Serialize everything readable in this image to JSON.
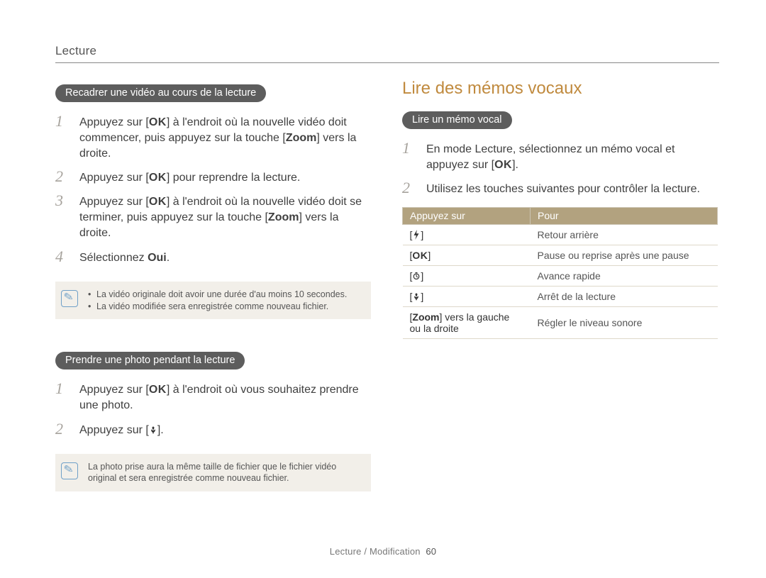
{
  "header": {
    "section": "Lecture"
  },
  "footer": {
    "breadcrumb": "Lecture / Modification",
    "page_number": "60"
  },
  "left": {
    "pill1": "Recadrer une vidéo au cours de la lecture",
    "steps1": {
      "s1a": "Appuyez sur [",
      "s1b": "] à l'endroit où la nouvelle vidéo doit commencer, puis appuyez sur la touche [",
      "s1c": "] vers la droite.",
      "s1_zoom": "Zoom",
      "s2a": "Appuyez sur [",
      "s2b": "] pour reprendre la lecture.",
      "s3a": "Appuyez sur [",
      "s3b": "] à l'endroit où la nouvelle vidéo doit se terminer, puis appuyez sur la touche [",
      "s3c": "] vers la droite.",
      "s3_zoom": "Zoom",
      "s4a": "Sélectionnez ",
      "s4b": "Oui",
      "s4c": "."
    },
    "note1": {
      "b1": "La vidéo originale doit avoir une durée d'au moins 10 secondes.",
      "b2": "La vidéo modifiée sera enregistrée comme nouveau fichier."
    },
    "pill2": "Prendre une photo pendant la lecture",
    "steps2": {
      "s1a": "Appuyez sur [",
      "s1b": "] à l'endroit où vous souhaitez prendre une photo.",
      "s2a": "Appuyez sur [",
      "s2b": "]."
    },
    "note2": "La photo prise aura la même taille de fichier que le fichier vidéo original et sera enregistrée comme nouveau fichier."
  },
  "right": {
    "title": "Lire des mémos vocaux",
    "pill": "Lire un mémo vocal",
    "steps": {
      "s1a": "En mode Lecture, sélectionnez un mémo vocal et appuyez sur [",
      "s1b": "].",
      "s2": "Utilisez les touches suivantes pour contrôler la lecture."
    },
    "table": {
      "head": {
        "c1": "Appuyez sur",
        "c2": "Pour"
      },
      "rows": [
        {
          "key_open": "[",
          "icon": "bolt-icon",
          "key_close": "]",
          "desc": "Retour arrière"
        },
        {
          "key_open": "[",
          "icon": "ok",
          "key_close": "]",
          "desc": "Pause ou reprise après une pause"
        },
        {
          "key_open": "[",
          "icon": "timer-icon",
          "key_close": "]",
          "desc": "Avance rapide"
        },
        {
          "key_open": "[",
          "icon": "macro-icon",
          "key_close": "]",
          "desc": "Arrêt de la lecture"
        },
        {
          "key_text_a": "[",
          "key_text_b": "Zoom",
          "key_text_c": "] vers la gauche ou la droite",
          "desc": "Régler le niveau sonore"
        }
      ]
    }
  },
  "glyphs": {
    "OK": "OK"
  }
}
